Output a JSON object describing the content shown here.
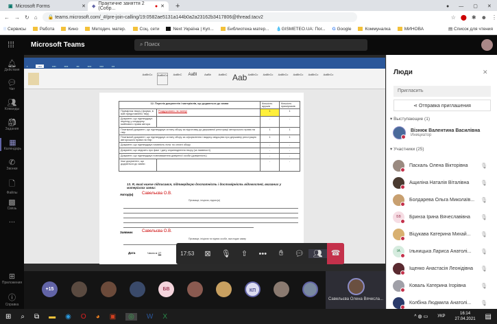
{
  "browser": {
    "tabs": [
      {
        "title": "Microsoft Forms",
        "active": false
      },
      {
        "title": "Практичне заняття 2 (Собр...",
        "active": true
      }
    ],
    "url": "teams.microsoft.com/_#/pre-join-calling/19:0582ae5131a144b0a2a23162b3417806@thread.tacv2",
    "bookmarks": [
      "Сервисы",
      "Работа",
      "Кино",
      "Методич. матер.",
      "Соц. сети",
      "Next Україна | Куп...",
      "Библиотека матер...",
      "GISMETEO.UA: Пог...",
      "Google",
      "Коммуналка",
      "МИНОВА"
    ],
    "reading_list": "Список для чтения"
  },
  "teams": {
    "title": "Microsoft Teams",
    "search_placeholder": "Поиск",
    "rail": [
      {
        "label": "Действия",
        "icon": "bell-icon"
      },
      {
        "label": "Чат",
        "icon": "chat-icon"
      },
      {
        "label": "Команды",
        "icon": "teams-icon"
      },
      {
        "label": "Задания",
        "icon": "assignments-icon"
      },
      {
        "label": "Календарь",
        "icon": "calendar-icon",
        "active": true
      },
      {
        "label": "Звонки",
        "icon": "phone-icon"
      },
      {
        "label": "Файлы",
        "icon": "file-icon"
      },
      {
        "label": "Связь",
        "icon": "apps-icon"
      },
      {
        "label": "...",
        "icon": "more-icon"
      }
    ],
    "rail_bottom": [
      {
        "label": "Приложения",
        "icon": "apps-grid-icon"
      },
      {
        "label": "Справка",
        "icon": "help-icon"
      }
    ]
  },
  "document": {
    "section12_title": "12. Перелік документів і матеріалів, що додаються до заяви",
    "col_copies": "Кількість арушів",
    "col_instances": "Кількість примірників",
    "rows": [
      {
        "text": "Примірник твору (форма, в якій представлено твір)",
        "note": "Роздруковано на папері",
        "copies": "1",
        "inst": "1"
      },
      {
        "text": "Документ, що підтверджує перехід у спадщину майнового права автора",
        "copies": "-",
        "inst": "-"
      },
      {
        "text": "Платіжний документ, що підтверджує сплату збору за підготовку до державної реєстрації авторського права на твір",
        "copies": "1",
        "inst": "1"
      },
      {
        "text": "Платіжний документ, що підтверджує сплату збору за оформлення і видачу свідоцтва про державну реєстрацію авторського права на твір",
        "copies": "1",
        "inst": "1"
      },
      {
        "text": "Документ, що підтверджує наявність пільг по сплаті збору",
        "copies": "-",
        "inst": "-"
      },
      {
        "text": "Документ, що свідчить про факт і дату оприлюднення твору (за наявності)",
        "copies": "-",
        "inst": "-"
      },
      {
        "text": "Документ, що підтверджує повноваження довіреної особи (довіреність)",
        "copies": "-",
        "inst": "-"
      },
      {
        "text": "Інші документи, що додаються до заяви",
        "copies": "-",
        "inst": "-"
      }
    ],
    "section13": "13. Я, який нижче підписався, підтверджую достатність і достовірність відомостей, вказаних у матеріалах заяви:",
    "author_label": "Автор(и)",
    "author_value": "Савельєва О.В.",
    "author_hint": "Прізвище, ініціали, підпис(и)",
    "applicant_label": "Заявник",
    "applicant_value": "Савельєва О.В.",
    "applicant_hint": "Прізвище, ініціали та підпис особи, яка подає заяву",
    "date_label": "Дата",
    "day_label": "Число",
    "day_value": "27"
  },
  "call": {
    "timer": "17:53"
  },
  "strip": {
    "overflow": "+15",
    "initials": [
      "БВ",
      "КП"
    ],
    "self_name": "Савельєва Олена Вячесла..."
  },
  "people": {
    "title": "Люди",
    "invite_placeholder": "Пригласить",
    "share_invite": "Отправка приглашения",
    "presenters_header": "Выступающие (1)",
    "presenter": {
      "name": "Візнюк Валентина Василівна",
      "role": "Инициатор"
    },
    "attendees_header": "Участники (25)",
    "attendees": [
      {
        "name": "Паскаль Олена Вікторівна"
      },
      {
        "name": "Ащиліна Наталія Віталівна"
      },
      {
        "name": "Болдарева Ольга Миколаїв..."
      },
      {
        "name": "Бринза Ірина Вячеславівна",
        "initials": "БВ"
      },
      {
        "name": "Віцукава Катерина Михай..."
      },
      {
        "name": "Ільницька Лариса Анатолі...",
        "initials": "ІА"
      },
      {
        "name": "Іщенко Анастасія Леонідівна"
      },
      {
        "name": "Коваль Катерина Ігорівна"
      },
      {
        "name": "Колбіна Людмила Анатолі..."
      }
    ]
  },
  "taskbar": {
    "lang": "УКР",
    "time": "16:14",
    "date": "27.04.2021"
  },
  "colors": {
    "teams_accent": "#6264a7",
    "hangup": "#c4314b",
    "word_blue": "#2b579a"
  }
}
